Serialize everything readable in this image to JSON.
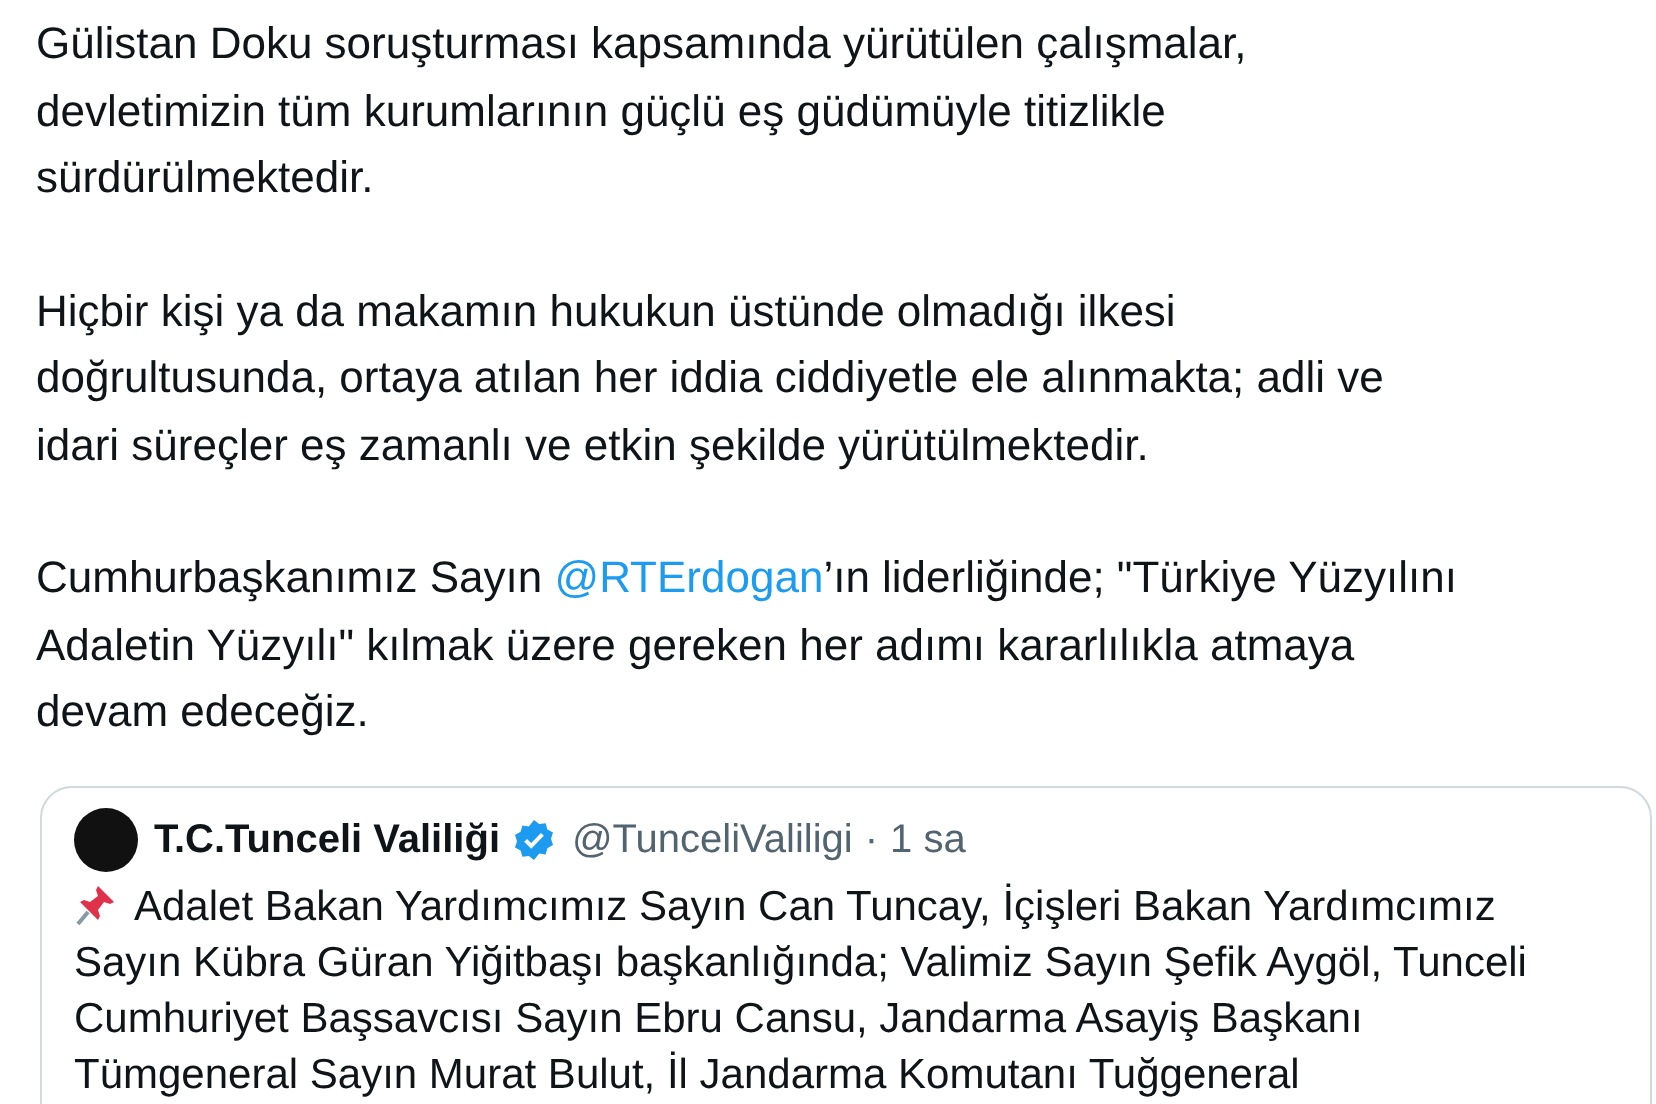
{
  "post": {
    "paragraphs": [
      {
        "lines": [
          [
            {
              "text": "Gülistan Doku soruşturması kapsamında yürütülen çalışmalar,"
            }
          ],
          [
            {
              "text": "devletimizin tüm kurumlarının güçlü eş güdümüyle titizlikle"
            }
          ],
          [
            {
              "text": "sürdürülmektedir."
            }
          ]
        ]
      },
      {
        "lines": [
          [
            {
              "text": "Hiçbir kişi ya da makamın hukukun üstünde olmadığı ilkesi"
            }
          ],
          [
            {
              "text": "doğrultusunda, ortaya atılan her iddia ciddiyetle ele alınmakta; adli ve"
            }
          ],
          [
            {
              "text": "idari süreçler eş zamanlı ve etkin şekilde yürütülmektedir."
            }
          ]
        ]
      },
      {
        "lines": [
          [
            {
              "text": "Cumhurbaşkanımız Sayın "
            },
            {
              "mention": "@RTErdogan"
            },
            {
              "text": "’ın liderliğinde; \"Türkiye Yüzyılını"
            }
          ],
          [
            {
              "text": "Adaletin Yüzyılı\" kılmak üzere gereken her adımı kararlılıkla atmaya"
            }
          ],
          [
            {
              "text": "devam edeceğiz."
            }
          ]
        ]
      }
    ]
  },
  "quoted_post": {
    "author": "T.C.Tunceli Valiliği",
    "verified": true,
    "handle": "@TunceliValiligi",
    "separator": "·",
    "time": "1 sa",
    "lines": [
      "Adalet Bakan Yardımcımız Sayın Can Tuncay, İçişleri Bakan Yardımcımız",
      "Sayın Kübra Güran Yiğitbaşı başkanlığında; Valimiz Sayın Şefik Aygöl, Tunceli",
      "Cumhuriyet Başsavcısı Sayın Ebru Cansu, Jandarma Asayiş Başkanı",
      "Tümgeneral Sayın Murat Bulut, İl Jandarma Komutanı Tuğgeneral"
    ]
  }
}
